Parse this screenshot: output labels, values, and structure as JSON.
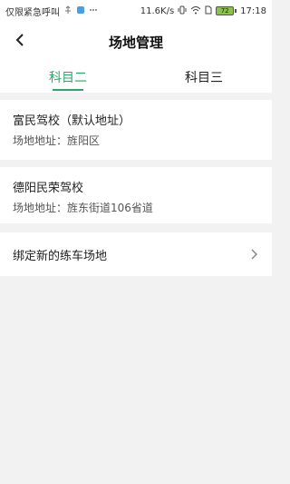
{
  "status_bar": {
    "carrier_text": "仅限紧急呼叫",
    "network_speed": "11.6K/s",
    "battery_level": "72",
    "time": "17:18"
  },
  "header": {
    "title": "场地管理"
  },
  "tabs": [
    {
      "label": "科目二",
      "active": true
    },
    {
      "label": "科目三",
      "active": false
    }
  ],
  "venues": [
    {
      "name": "富民驾校（默认地址）",
      "address_label": "场地地址：",
      "address": "旌阳区"
    },
    {
      "name": "德阳民荣驾校",
      "address_label": "场地地址：",
      "address": "旌东街道106省道"
    }
  ],
  "bind_row": {
    "label": "绑定新的练车场地"
  },
  "colors": {
    "accent": "#2aa868",
    "background": "#f2f2f2"
  }
}
